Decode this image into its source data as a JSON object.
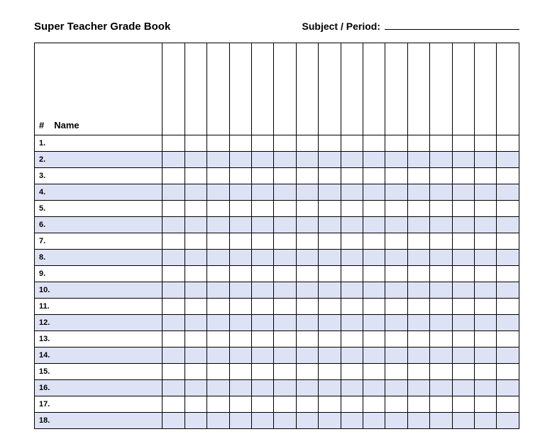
{
  "header": {
    "title": "Super Teacher Grade Book",
    "subject_label": "Subject / Period:"
  },
  "table": {
    "hash_symbol": "#",
    "name_label": "Name",
    "grade_columns": 16,
    "rows": [
      {
        "num": "1."
      },
      {
        "num": "2."
      },
      {
        "num": "3."
      },
      {
        "num": "4."
      },
      {
        "num": "5."
      },
      {
        "num": "6."
      },
      {
        "num": "7."
      },
      {
        "num": "8."
      },
      {
        "num": "9."
      },
      {
        "num": "10."
      },
      {
        "num": "11."
      },
      {
        "num": "12."
      },
      {
        "num": "13."
      },
      {
        "num": "14."
      },
      {
        "num": "15."
      },
      {
        "num": "16."
      },
      {
        "num": "17."
      },
      {
        "num": "18."
      }
    ]
  }
}
